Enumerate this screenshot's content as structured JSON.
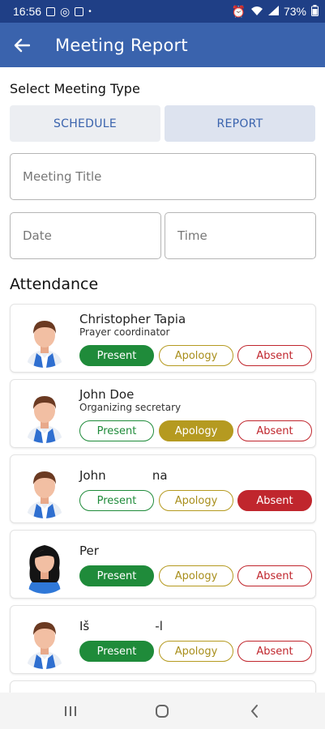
{
  "status_bar": {
    "time": "16:56",
    "battery": "73%",
    "left_icons": [
      "gallery-icon",
      "whatsapp-icon",
      "sim-icon",
      "dot-icon"
    ],
    "right_icons": [
      "alarm-icon",
      "wifi-icon",
      "signal-icon",
      "battery-icon"
    ]
  },
  "app_bar": {
    "title": "Meeting Report",
    "back_icon": "arrow-left-icon"
  },
  "meeting_type": {
    "label": "Select Meeting Type",
    "options": [
      "SCHEDULE",
      "REPORT"
    ],
    "selected": "REPORT"
  },
  "form": {
    "title_placeholder": "Meeting Title",
    "date_placeholder": "Date",
    "time_placeholder": "Time"
  },
  "attendance": {
    "heading": "Attendance",
    "status_labels": {
      "present": "Present",
      "apology": "Apology",
      "absent": "Absent"
    },
    "members": [
      {
        "name": "Christopher Tapia",
        "role": "Prayer coordinator",
        "status": "present",
        "avatar": "male-avatar"
      },
      {
        "name": "John Doe",
        "role": "Organizing secretary",
        "status": "apology",
        "avatar": "male-avatar"
      },
      {
        "name": "John            na",
        "role": "",
        "status": "absent",
        "avatar": "male-avatar"
      },
      {
        "name": "Per",
        "role": "",
        "status": "present",
        "avatar": "female-avatar"
      },
      {
        "name": "Iš                 -l",
        "role": "",
        "status": "present",
        "avatar": "male-avatar"
      }
    ]
  },
  "colors": {
    "status_bar": "#1f3f86",
    "app_bar": "#3a63ad",
    "present": "#1f8b3a",
    "apology": "#b59a20",
    "absent": "#c0262d"
  },
  "nav_bar": {
    "buttons": [
      "recents-icon",
      "home-icon",
      "back-icon"
    ]
  }
}
